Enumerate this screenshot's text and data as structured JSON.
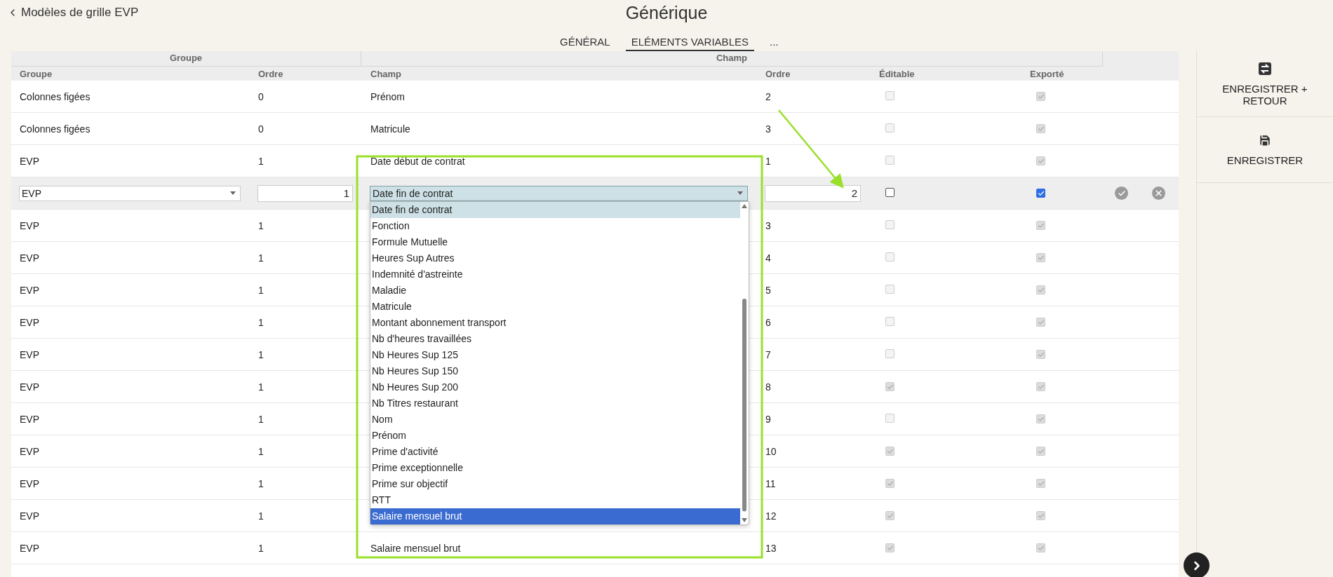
{
  "header": {
    "back_link": "Modèles de grille EVP",
    "title": "Générique"
  },
  "tabs": [
    {
      "label": "GÉNÉRAL",
      "selected": false
    },
    {
      "label": "ELÉMENTS VARIABLES",
      "selected": true
    },
    {
      "label": "...",
      "selected": false
    }
  ],
  "table": {
    "column_groups": [
      "Groupe",
      "Champ"
    ],
    "columns": [
      "Groupe",
      "Ordre",
      "Champ",
      "Ordre",
      "Éditable",
      "Exporté"
    ],
    "rows": [
      {
        "kind": "view",
        "group": "Colonnes figées",
        "order": "0",
        "field": "Prénom",
        "field_order": "2",
        "editable": false,
        "exported": true
      },
      {
        "kind": "view",
        "group": "Colonnes figées",
        "order": "0",
        "field": "Matricule",
        "field_order": "3",
        "editable": false,
        "exported": true
      },
      {
        "kind": "view",
        "group": "EVP",
        "order": "1",
        "field": "Date début de contrat",
        "field_order": "1",
        "editable": false,
        "exported": true
      },
      {
        "kind": "edit",
        "group": "EVP",
        "order": "1",
        "field": "Date fin de contrat",
        "field_order": "2",
        "editable": false,
        "exported": true
      },
      {
        "kind": "view",
        "group": "EVP",
        "order": "1",
        "field_order": "3",
        "editable": false,
        "exported": true
      },
      {
        "kind": "view",
        "group": "EVP",
        "order": "1",
        "field_order": "4",
        "editable": false,
        "exported": true
      },
      {
        "kind": "view",
        "group": "EVP",
        "order": "1",
        "field_order": "5",
        "editable": false,
        "exported": true
      },
      {
        "kind": "view",
        "group": "EVP",
        "order": "1",
        "field_order": "6",
        "editable": false,
        "exported": true
      },
      {
        "kind": "view",
        "group": "EVP",
        "order": "1",
        "field_order": "7",
        "editable": false,
        "exported": true
      },
      {
        "kind": "view",
        "group": "EVP",
        "order": "1",
        "field_order": "8",
        "editable": true,
        "exported": true
      },
      {
        "kind": "view",
        "group": "EVP",
        "order": "1",
        "field_order": "9",
        "editable": false,
        "exported": true
      },
      {
        "kind": "view",
        "group": "EVP",
        "order": "1",
        "field_order": "10",
        "editable": true,
        "exported": true
      },
      {
        "kind": "view",
        "group": "EVP",
        "order": "1",
        "field_order": "11",
        "editable": true,
        "exported": true
      },
      {
        "kind": "view",
        "group": "EVP",
        "order": "1",
        "field_order": "12",
        "editable": true,
        "exported": true
      },
      {
        "kind": "view",
        "group": "EVP",
        "order": "1",
        "field": "Salaire mensuel brut",
        "field_order": "13",
        "editable": true,
        "exported": true
      }
    ]
  },
  "dropdown": {
    "options": [
      {
        "label": "Date fin de contrat",
        "current": true,
        "selected": false
      },
      {
        "label": "Fonction",
        "current": false,
        "selected": false
      },
      {
        "label": "Formule Mutuelle",
        "current": false,
        "selected": false
      },
      {
        "label": "Heures Sup Autres",
        "current": false,
        "selected": false
      },
      {
        "label": "Indemnité d'astreinte",
        "current": false,
        "selected": false
      },
      {
        "label": "Maladie",
        "current": false,
        "selected": false
      },
      {
        "label": "Matricule",
        "current": false,
        "selected": false
      },
      {
        "label": "Montant abonnement transport",
        "current": false,
        "selected": false
      },
      {
        "label": "Nb d'heures travaillées",
        "current": false,
        "selected": false
      },
      {
        "label": "Nb Heures Sup 125",
        "current": false,
        "selected": false
      },
      {
        "label": "Nb Heures Sup 150",
        "current": false,
        "selected": false
      },
      {
        "label": "Nb Heures Sup 200",
        "current": false,
        "selected": false
      },
      {
        "label": "Nb Titres restaurant",
        "current": false,
        "selected": false
      },
      {
        "label": "Nom",
        "current": false,
        "selected": false
      },
      {
        "label": "Prénom",
        "current": false,
        "selected": false
      },
      {
        "label": "Prime d'activité",
        "current": false,
        "selected": false
      },
      {
        "label": "Prime exceptionnelle",
        "current": false,
        "selected": false
      },
      {
        "label": "Prime sur objectif",
        "current": false,
        "selected": false
      },
      {
        "label": "RTT",
        "current": false,
        "selected": false
      },
      {
        "label": "Salaire mensuel brut",
        "current": false,
        "selected": true
      }
    ]
  },
  "side_buttons": [
    {
      "kind": "save_return",
      "label": "ENREGISTRER + RETOUR"
    },
    {
      "kind": "save",
      "label": "ENREGISTRER"
    }
  ]
}
